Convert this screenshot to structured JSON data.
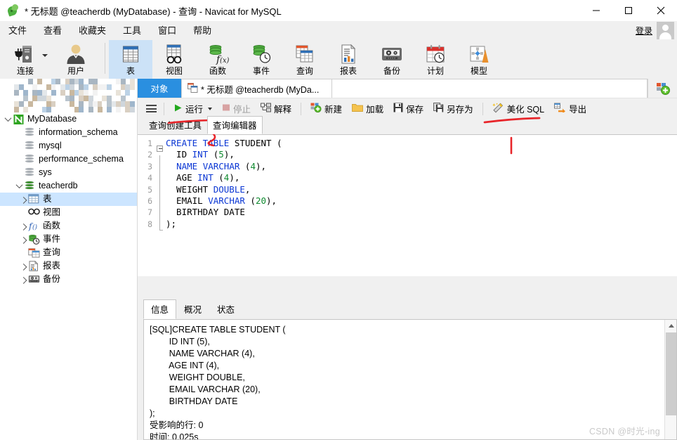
{
  "window": {
    "title": "* 无标题 @teacherdb (MyDatabase) - 查询 - Navicat for MySQL",
    "minimize_label": "—",
    "maximize_label": "□",
    "close_label": "✕"
  },
  "menubar": {
    "items": [
      {
        "label": "文件"
      },
      {
        "label": "查看"
      },
      {
        "label": "收藏夹"
      },
      {
        "label": "工具"
      },
      {
        "label": "窗口"
      },
      {
        "label": "帮助"
      }
    ],
    "login_label": "登录"
  },
  "ribbon": {
    "items": [
      {
        "label": "连接",
        "icon": "connection-icon",
        "has_dropdown": true,
        "selected": false
      },
      {
        "label": "用户",
        "icon": "user-icon",
        "has_dropdown": false,
        "selected": false
      },
      {
        "label": "表",
        "icon": "table-icon",
        "has_dropdown": false,
        "selected": true
      },
      {
        "label": "视图",
        "icon": "view-icon",
        "has_dropdown": false,
        "selected": false
      },
      {
        "label": "函数",
        "icon": "function-icon",
        "has_dropdown": false,
        "selected": false
      },
      {
        "label": "事件",
        "icon": "event-icon",
        "has_dropdown": false,
        "selected": false
      },
      {
        "label": "查询",
        "icon": "query-icon",
        "has_dropdown": false,
        "selected": false
      },
      {
        "label": "报表",
        "icon": "report-icon",
        "has_dropdown": false,
        "selected": false
      },
      {
        "label": "备份",
        "icon": "backup-icon",
        "has_dropdown": false,
        "selected": false
      },
      {
        "label": "计划",
        "icon": "schedule-icon",
        "has_dropdown": false,
        "selected": false
      },
      {
        "label": "模型",
        "icon": "model-icon",
        "has_dropdown": false,
        "selected": false
      }
    ]
  },
  "sidebar": {
    "tree": [
      {
        "label": "MyDatabase",
        "level": 0,
        "icon": "connection-green-icon",
        "expander": "down",
        "selected": false
      },
      {
        "label": "information_schema",
        "level": 1,
        "icon": "database-gray-icon",
        "expander": "none",
        "selected": false
      },
      {
        "label": "mysql",
        "level": 1,
        "icon": "database-gray-icon",
        "expander": "none",
        "selected": false
      },
      {
        "label": "performance_schema",
        "level": 1,
        "icon": "database-gray-icon",
        "expander": "none",
        "selected": false
      },
      {
        "label": "sys",
        "level": 1,
        "icon": "database-gray-icon",
        "expander": "none",
        "selected": false
      },
      {
        "label": "teacherdb",
        "level": 1,
        "icon": "database-green-icon",
        "expander": "down",
        "selected": false
      },
      {
        "label": "表",
        "level": 2,
        "icon": "table-icon",
        "expander": "right",
        "selected": true
      },
      {
        "label": "视图",
        "level": 2,
        "icon": "view-icon",
        "expander": "none",
        "selected": false
      },
      {
        "label": "函数",
        "level": 2,
        "icon": "function-icon",
        "expander": "right",
        "selected": false
      },
      {
        "label": "事件",
        "level": 2,
        "icon": "event-icon",
        "expander": "right",
        "selected": false
      },
      {
        "label": "查询",
        "level": 2,
        "icon": "query-icon",
        "expander": "none",
        "selected": false
      },
      {
        "label": "报表",
        "level": 2,
        "icon": "report-icon",
        "expander": "right",
        "selected": false
      },
      {
        "label": "备份",
        "level": 2,
        "icon": "backup-icon",
        "expander": "right",
        "selected": false
      }
    ]
  },
  "tabs": {
    "object_tab": "对象",
    "query_tab": "* 无标题 @teacherdb (MyDa...",
    "add_tab_icon": "new-tab-icon"
  },
  "editor_toolbar": {
    "menu_icon": "hamburger-menu-icon",
    "buttons": [
      {
        "label": "运行",
        "icon": "play-icon",
        "disabled": false,
        "has_dropdown": true
      },
      {
        "label": "停止",
        "icon": "stop-icon",
        "disabled": true,
        "has_dropdown": false
      },
      {
        "label": "解释",
        "icon": "explain-icon",
        "disabled": false,
        "has_dropdown": false
      },
      {
        "label": "新建",
        "icon": "new-icon",
        "disabled": false,
        "has_dropdown": false
      },
      {
        "label": "加载",
        "icon": "folder-icon",
        "disabled": false,
        "has_dropdown": false
      },
      {
        "label": "保存",
        "icon": "save-icon",
        "disabled": false,
        "has_dropdown": false
      },
      {
        "label": "另存为",
        "icon": "save-as-icon",
        "disabled": false,
        "has_dropdown": false
      },
      {
        "label": "美化 SQL",
        "icon": "beautify-icon",
        "disabled": false,
        "has_dropdown": false
      },
      {
        "label": "导出",
        "icon": "export-icon",
        "disabled": false,
        "has_dropdown": false
      }
    ]
  },
  "sub_tabs": {
    "items": [
      {
        "label": "查询创建工具",
        "active": false
      },
      {
        "label": "查询编辑器",
        "active": true
      }
    ]
  },
  "code": {
    "lines": [
      {
        "n": "1",
        "fold": "start",
        "tokens": [
          {
            "t": "CREATE TABLE",
            "c": "kw"
          },
          {
            "t": " STUDENT (",
            "c": "pl"
          }
        ]
      },
      {
        "n": "2",
        "fold": "bar",
        "tokens": [
          {
            "t": "  ID ",
            "c": "pl"
          },
          {
            "t": "INT",
            "c": "kw"
          },
          {
            "t": " (",
            "c": "pl"
          },
          {
            "t": "5",
            "c": "num"
          },
          {
            "t": "),",
            "c": "pl"
          }
        ]
      },
      {
        "n": "3",
        "fold": "bar",
        "tokens": [
          {
            "t": "  ",
            "c": "pl"
          },
          {
            "t": "NAME VARCHAR",
            "c": "kw"
          },
          {
            "t": " (",
            "c": "pl"
          },
          {
            "t": "4",
            "c": "num"
          },
          {
            "t": "),",
            "c": "pl"
          }
        ]
      },
      {
        "n": "4",
        "fold": "bar",
        "tokens": [
          {
            "t": "  AGE ",
            "c": "pl"
          },
          {
            "t": "INT",
            "c": "kw"
          },
          {
            "t": " (",
            "c": "pl"
          },
          {
            "t": "4",
            "c": "num"
          },
          {
            "t": "),",
            "c": "pl"
          }
        ]
      },
      {
        "n": "5",
        "fold": "bar",
        "tokens": [
          {
            "t": "  WEIGHT ",
            "c": "pl"
          },
          {
            "t": "DOUBLE",
            "c": "kw"
          },
          {
            "t": ",",
            "c": "pl"
          }
        ]
      },
      {
        "n": "6",
        "fold": "bar",
        "tokens": [
          {
            "t": "  EMAIL ",
            "c": "pl"
          },
          {
            "t": "VARCHAR",
            "c": "kw"
          },
          {
            "t": " (",
            "c": "pl"
          },
          {
            "t": "20",
            "c": "num"
          },
          {
            "t": "),",
            "c": "pl"
          }
        ]
      },
      {
        "n": "7",
        "fold": "bar",
        "tokens": [
          {
            "t": "  BIRTHDAY DATE",
            "c": "pl"
          }
        ]
      },
      {
        "n": "8",
        "fold": "end",
        "tokens": [
          {
            "t": ");",
            "c": "pl"
          }
        ]
      }
    ]
  },
  "results": {
    "tabs": [
      {
        "label": "信息",
        "active": true
      },
      {
        "label": "概况",
        "active": false
      },
      {
        "label": "状态",
        "active": false
      }
    ],
    "output": "[SQL]CREATE TABLE STUDENT (\n        ID INT (5),\n        NAME VARCHAR (4),\n        AGE INT (4),\n        WEIGHT DOUBLE,\n        EMAIL VARCHAR (20),\n        BIRTHDAY DATE\n);\n受影响的行: 0\n时间: 0.025s"
  },
  "watermark": "CSDN @时光-ing",
  "colors": {
    "accent_blue": "#2a8fe0",
    "selection_blue": "#cce5ff",
    "ribbon_selected": "#cce2f7",
    "annotation_red": "#e8252a",
    "keyword": "#0b37d4",
    "number": "#0f8a2f"
  }
}
